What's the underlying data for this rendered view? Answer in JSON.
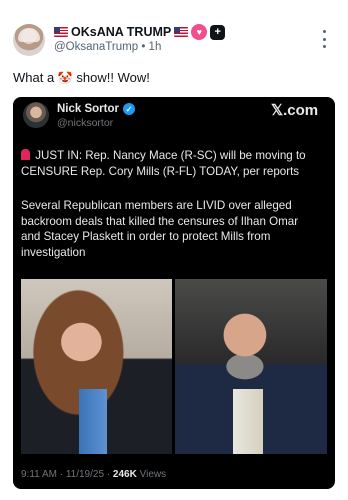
{
  "post": {
    "display_name": "OKsANA TRUMP",
    "handle": "@OksanaTrump",
    "separator": "•",
    "age": "1h",
    "text_before": "What a",
    "text_emoji": "🤡",
    "text_after": "show!! Wow!"
  },
  "icons": {
    "flag": "us-flag-icon",
    "heart_badge": "heart-badge-icon",
    "plus_badge": "plus-badge-icon",
    "more": "more-icon",
    "verified": "verified-icon",
    "siren": "siren-icon"
  },
  "quote": {
    "display_name": "Nick Sortor",
    "handle": "@nicksortor",
    "brand": "𝕏.com",
    "paragraph1": [
      "JUST IN: Rep. Nancy Mace (R-SC) will be moving to",
      "CENSURE Rep. Cory Mills (R-FL) TODAY, per reports"
    ],
    "paragraph2": [
      "Several Republican members are LIVID over alleged",
      "backroom deals that killed the censures of Ilhan Omar",
      "and Stacey Plaskett in order to protect Mills from",
      "investigation"
    ],
    "meta_time": "9:11 AM · 11/19/25 ·",
    "meta_views_count": "246K",
    "meta_views_label": "Views"
  },
  "colors": {
    "accent_blue": "#1d9bf0",
    "badge_pink": "#f24d8c",
    "quote_background": "#000000"
  }
}
